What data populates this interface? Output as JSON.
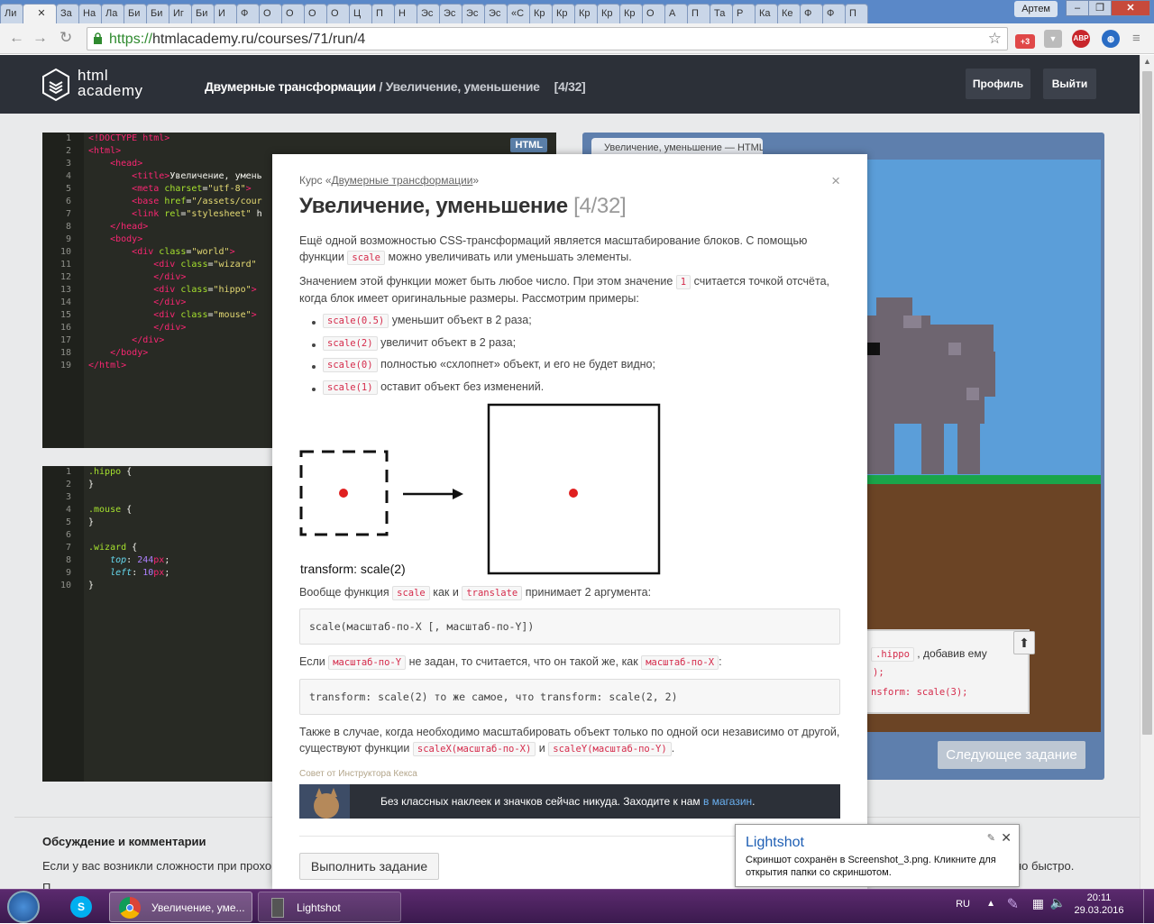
{
  "browser": {
    "tab_labels": [
      "Ли",
      "",
      "За",
      "На",
      "Ла",
      "Би",
      "Би",
      "Иг",
      "Би",
      "И",
      "Ф",
      "О",
      "О",
      "О",
      "О",
      "Ц",
      "П",
      "Н",
      "Эс",
      "Эс",
      "Эс",
      "Эс",
      "«С",
      "Кр",
      "Кр",
      "Кр",
      "Кр",
      "Кр",
      "О",
      "А",
      "П",
      "Та",
      "Р",
      "Ка",
      "Ке",
      "Ф",
      "Ф",
      "П"
    ],
    "active_tab_close": "✕",
    "user_name": "Артем",
    "url_scheme": "https://",
    "url_rest": "htmlacademy.ru/courses/71/run/4",
    "ext_badge": "+3",
    "abp": "ABP"
  },
  "header": {
    "logo_line1": "html",
    "logo_line2": "academy",
    "course": "Двумерные трансформации",
    "sep": " / ",
    "lesson": "Увеличение, уменьшение",
    "counter": "[4/32]",
    "profile_label": "Профиль",
    "logout_label": "Выйти"
  },
  "html_editor": {
    "badge": "HTML",
    "line_numbers": "1\n2\n3\n4\n5\n6\n7\n8\n9\n10\n11\n12\n13\n14\n15\n16\n17\n18\n19"
  },
  "css_editor": {
    "line_numbers": "1\n2\n3\n4\n5\n6\n7\n8\n9\n10"
  },
  "preview": {
    "tab_label": "Увеличение, уменьшение — HTML",
    "task_frag1": ".hippo",
    "task_frag2": ", добавив ему",
    "task_frag3": ");",
    "task_frag4": "nsform: scale(3);",
    "next_label": "Следующее задание"
  },
  "discussion": {
    "title": "Обсуждение и комментарии",
    "text": "Если у вас возникли сложности при прохо",
    "text_tail": "но быстро.",
    "text2": "П"
  },
  "modal": {
    "course_prefix": "Курс «",
    "course_link": "Двумерные трансформации",
    "course_suffix": "»",
    "close": "×",
    "title": "Увеличение, уменьшение",
    "step": "[4/32]",
    "p1a": "Ещё одной возможностью CSS-трансформаций является масштабирование блоков. С помощью функции",
    "p1code": "scale",
    "p1b": "можно увеличивать или уменьшать элементы.",
    "p2a": "Значением этой функции может быть любое число. При этом значение",
    "p2code": "1",
    "p2b": "считается точкой отсчёта, когда блок имеет оригинальные размеры. Рассмотрим примеры:",
    "list": [
      {
        "code": "scale(0.5)",
        "text": "уменьшит объект в 2 раза;"
      },
      {
        "code": "scale(2)",
        "text": "увеличит объект в 2 раза;"
      },
      {
        "code": "scale(0)",
        "text": "полностью «схлопнет» объект, и его не будет видно;"
      },
      {
        "code": "scale(1)",
        "text": "оставит объект без изменений."
      }
    ],
    "diagram_caption": "transform: scale(2)",
    "p3a": "Вообще функция",
    "p3code1": "scale",
    "p3b": "как и",
    "p3code2": "translate",
    "p3c": "принимает 2 аргумента:",
    "pre1": "scale(масштаб-по-X [, масштаб-по-Y])",
    "p4a": "Если",
    "p4code1": "масштаб-по-Y",
    "p4b": "не задан, то считается, что он такой же, как",
    "p4code2": "масштаб-по-X",
    "p4c": ":",
    "pre2": "transform: scale(2) то же самое, что transform: scale(2, 2)",
    "p5a": "Также в случае, когда необходимо масштабировать объект только по одной оси независимо от другой, существуют функции",
    "p5code1": "scaleX(масштаб-по-X)",
    "p5b": "и",
    "p5code2": "scaleY(масштаб-по-Y)",
    "p5c": ".",
    "tip_label": "Совет от Инструктора Кекса",
    "ad_text": "Без классных наклеек и значков сейчас никуда. Заходите к нам ",
    "ad_link": "в магазин",
    "ad_end": ".",
    "run_label": "Выполнить задание"
  },
  "lightshot": {
    "title": "Lightshot",
    "message": "Скриншот сохранён в Screenshot_3.png. Кликните для открытия папки со скриншотом."
  },
  "taskbar": {
    "chrome_label": "Увеличение, уме...",
    "lightshot_label": "Lightshot",
    "lang": "RU",
    "time": "20:11",
    "date": "29.03.2016"
  }
}
